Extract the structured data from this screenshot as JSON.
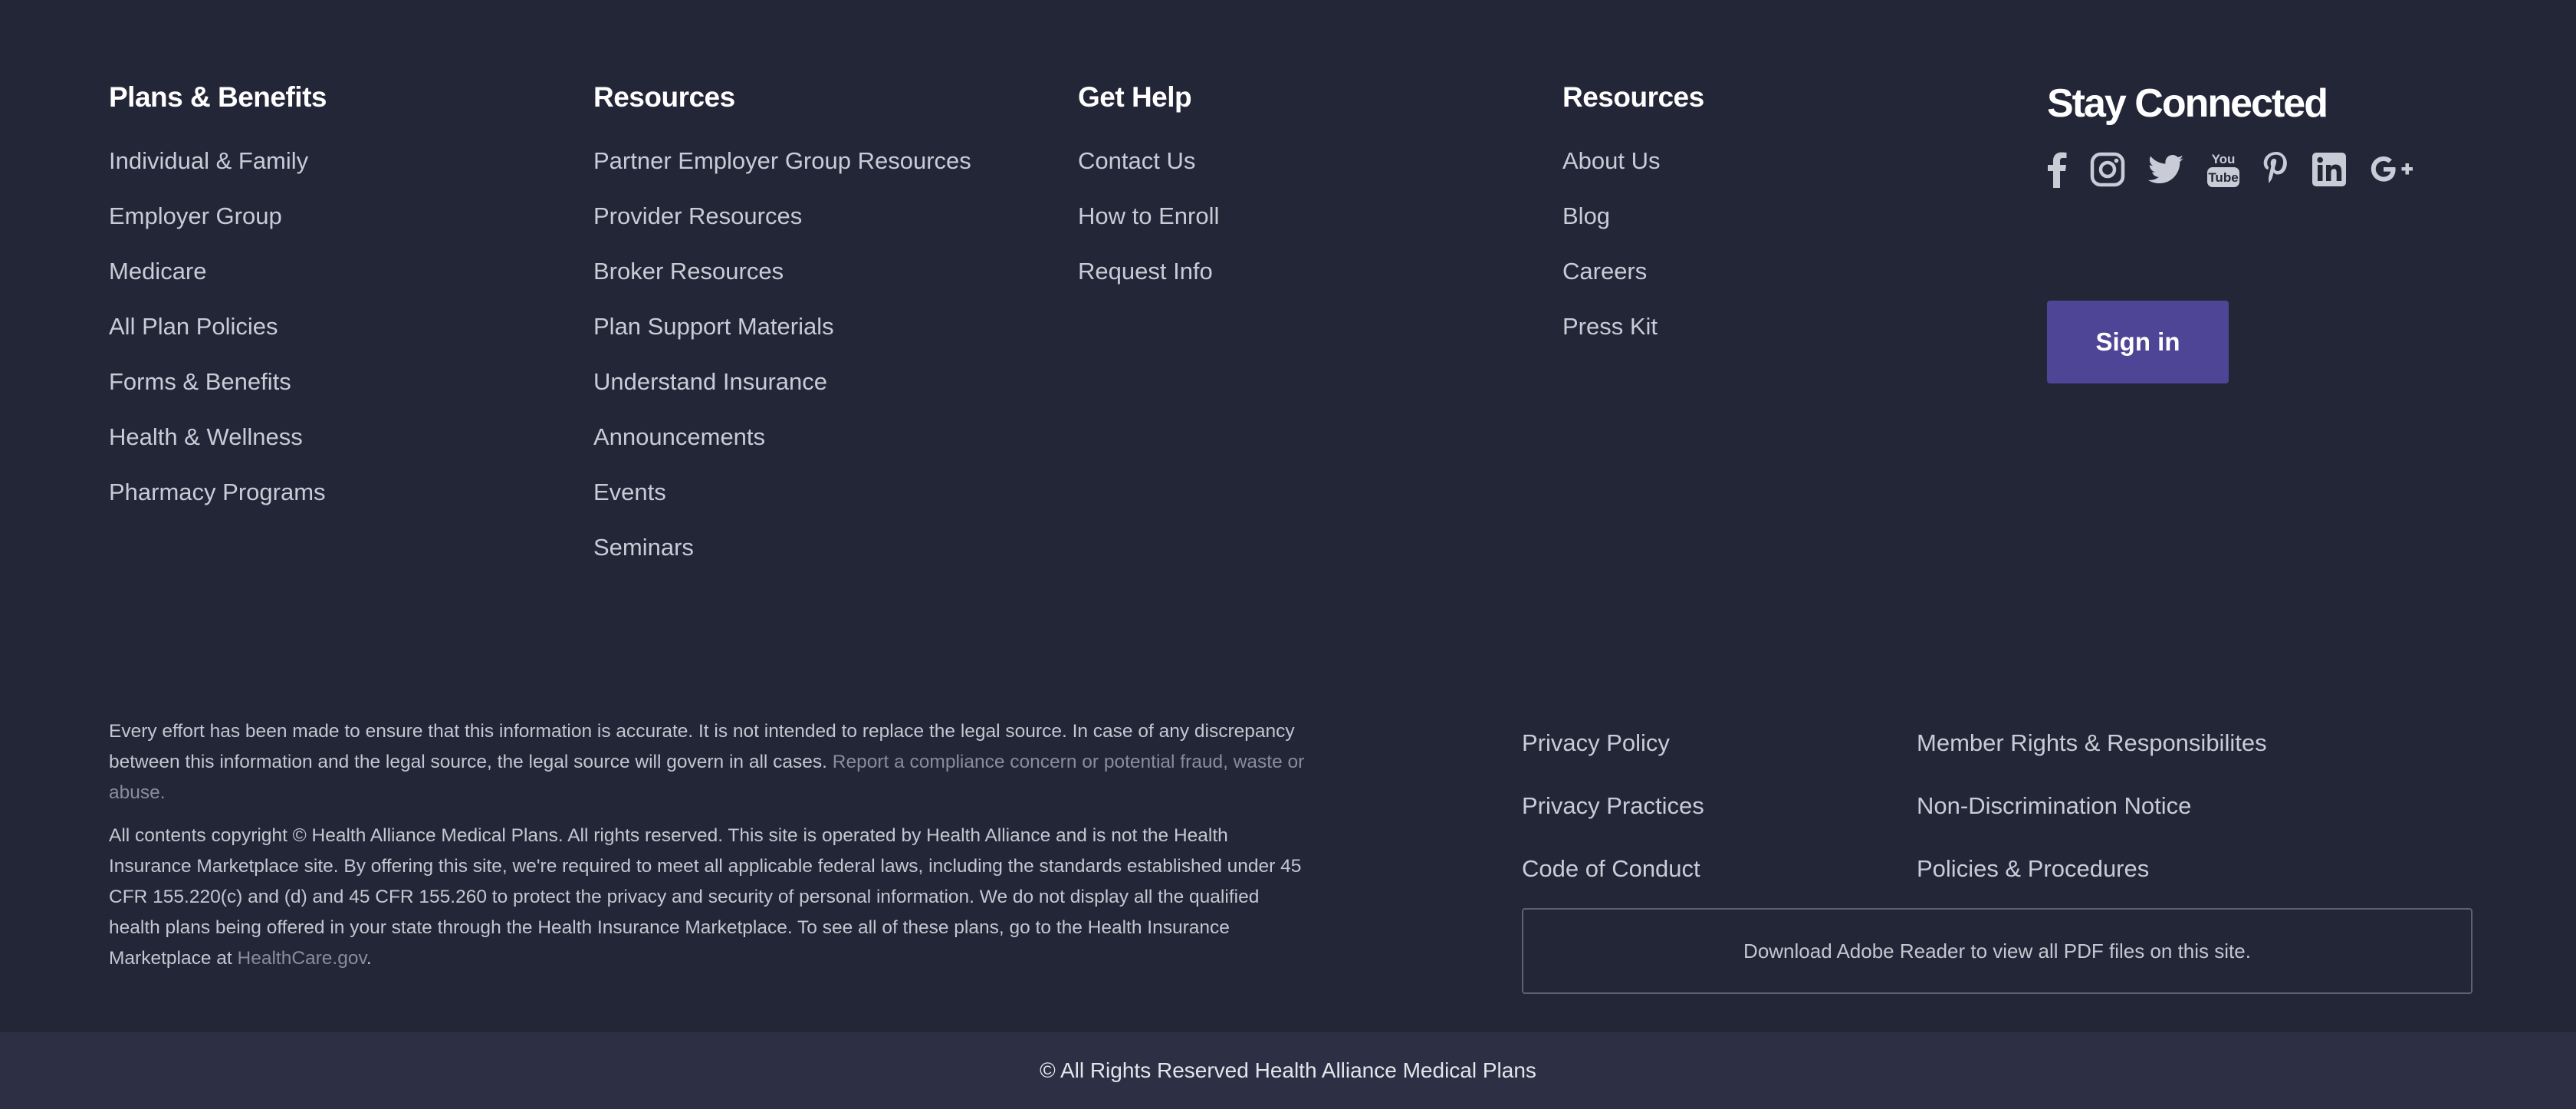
{
  "columns": {
    "plans": {
      "heading": "Plans & Benefits",
      "items": [
        "Individual & Family",
        "Employer Group",
        "Medicare",
        "All Plan Policies",
        "Forms & Benefits",
        "Health & Wellness",
        "Pharmacy Programs"
      ]
    },
    "resources": {
      "heading": "Resources",
      "items": [
        "Partner Employer Group Resources",
        "Provider Resources",
        "Broker Resources",
        "Plan Support Materials",
        "Understand Insurance",
        "Announcements",
        "Events",
        "Seminars"
      ]
    },
    "help": {
      "heading": "Get Help",
      "items": [
        "Contact Us",
        "How to Enroll",
        "Request Info"
      ]
    },
    "about": {
      "heading": "Resources",
      "items": [
        "About Us",
        "Blog",
        "Careers",
        "Press Kit"
      ]
    }
  },
  "connect": {
    "heading": "Stay Connected",
    "icons": [
      "facebook-icon",
      "instagram-icon",
      "twitter-icon",
      "youtube-icon",
      "pinterest-icon",
      "linkedin-icon",
      "google-plus-icon"
    ],
    "youtube_you": "You",
    "youtube_tube": "Tube",
    "signin_label": "Sign in"
  },
  "disclaimer": {
    "p1_text": "Every effort has been made to ensure that this information is accurate. It is not intended to replace the legal source. In case of any discrepancy between this information and the legal source, the legal source will govern in all cases. ",
    "p1_link": "Report a compliance concern or potential fraud, waste or abuse.",
    "p2_text": "All contents copyright © Health Alliance Medical Plans. All rights reserved. This site is operated by Health Alliance and is not the Health Insurance Marketplace site. By offering this site, we're required to meet all applicable federal laws, including the standards established under 45 CFR 155.220(c) and (d) and 45 CFR 155.260 to protect the privacy and security of personal information. We do not display all the qualified health plans being offered in your state through the Health Insurance Marketplace. To see all of these plans, go to the Health Insurance Marketplace at ",
    "p2_link": "HealthCare.gov",
    "p2_end": "."
  },
  "legal": {
    "col_a": [
      "Privacy Policy",
      "Privacy Practices",
      "Code of Conduct"
    ],
    "col_b": [
      "Member Rights & Responsibilites",
      "Non-Discrimination Notice",
      "Policies & Procedures"
    ]
  },
  "adobe_notice": "Download Adobe Reader to view all PDF files on this site.",
  "copyright": "© All Rights Reserved Health Alliance Medical Plans",
  "colors": {
    "background": "#232637",
    "bottom_bar": "#2d3044",
    "accent_button": "#4e4596",
    "link_muted": "#8a8c99"
  }
}
